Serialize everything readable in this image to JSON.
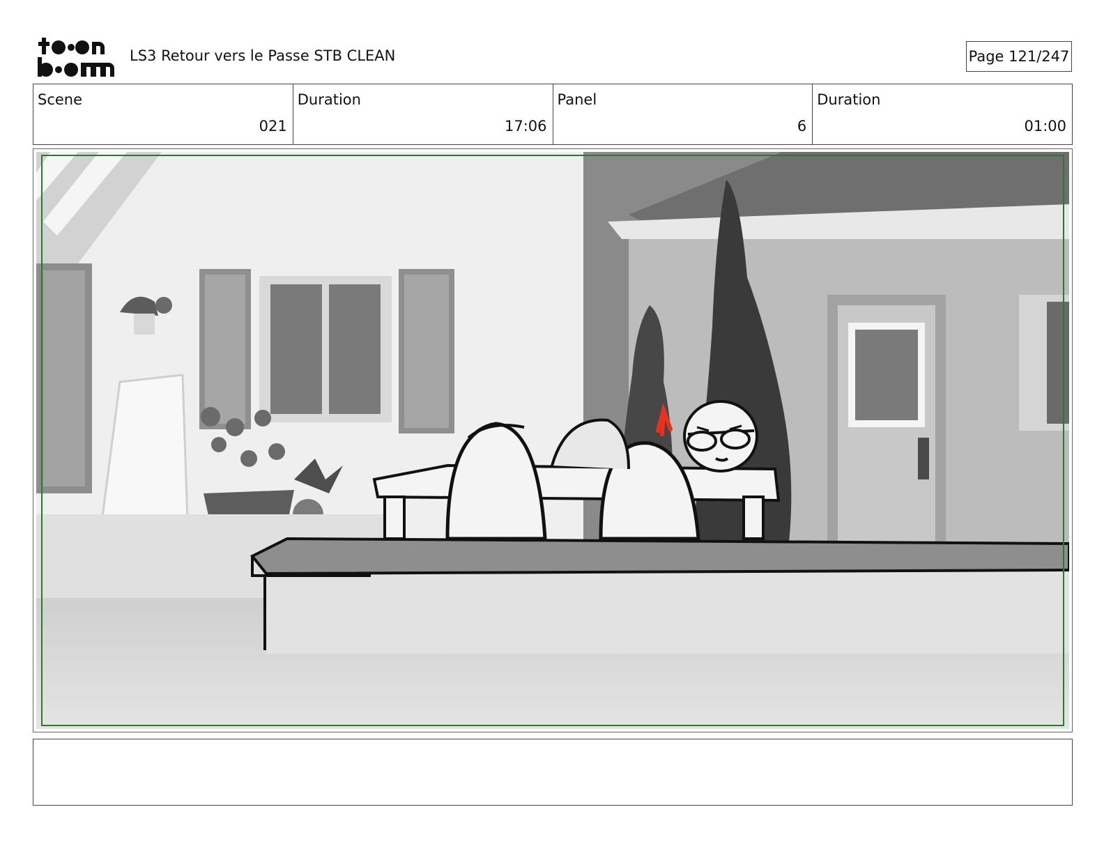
{
  "header": {
    "logo_text": "toon boom",
    "title": "LS3 Retour vers le Passe STB CLEAN",
    "page": "Page 121/247"
  },
  "info": {
    "scene_label": "Scene",
    "scene_value": "021",
    "scene_duration_label": "Duration",
    "scene_duration_value": "17:06",
    "panel_label": "Panel",
    "panel_value": "6",
    "panel_duration_label": "Duration",
    "panel_duration_value": "01:00"
  },
  "notes": {
    "text": ""
  },
  "colors": {
    "safe_frame": "#2a7a2a",
    "accent_arrow": "#e8321e"
  }
}
